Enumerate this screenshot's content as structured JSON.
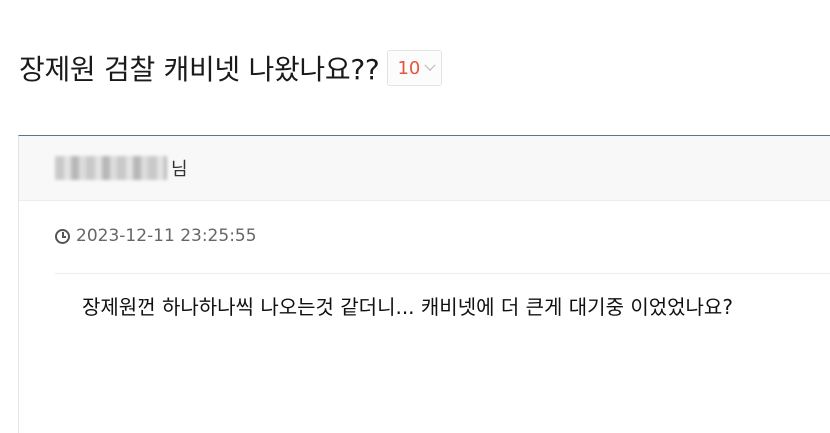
{
  "post": {
    "title": "장제원 검찰 캐비넷 나왔나요??",
    "comment_count": "10",
    "author_suffix": "님",
    "date": "2023-12-11 23:25:55",
    "content": "장제원껀 하나하나씩 나오는것 같더니... 캐비넷에 더 큰게 대기중 이었었나요?"
  },
  "icons": {
    "comment_dropdown": "chevron-down-icon",
    "date": "clock-icon"
  },
  "colors": {
    "comment_count": "#e8533d",
    "post_border_top": "#5f7582"
  }
}
